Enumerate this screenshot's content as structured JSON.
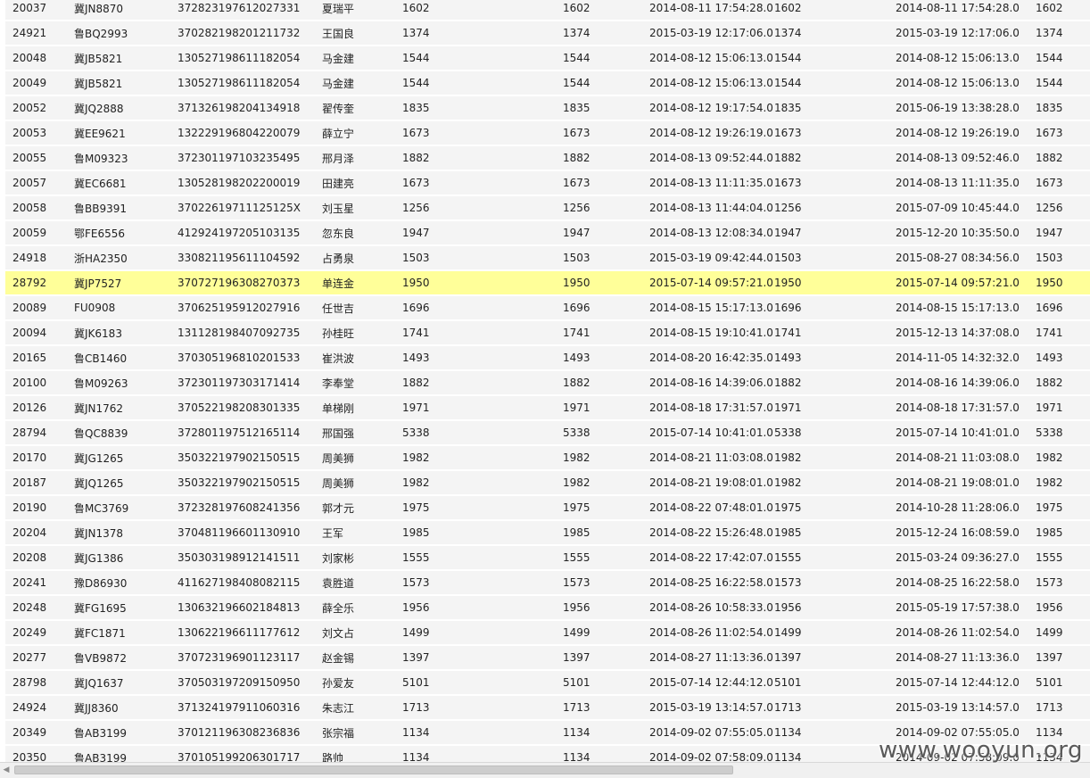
{
  "rows": [
    [
      "20037",
      "冀JN8870",
      "372823197612027331",
      "夏瑞平",
      "1602",
      "1602",
      "2014-08-11 17:54:28.0",
      "1602",
      "2014-08-11 17:54:28.0",
      "1602"
    ],
    [
      "24921",
      "鲁BQ2993",
      "370282198201211732",
      "王国良",
      "1374",
      "1374",
      "2015-03-19 12:17:06.0",
      "1374",
      "2015-03-19 12:17:06.0",
      "1374"
    ],
    [
      "20048",
      "冀JB5821",
      "130527198611182054",
      "马金建",
      "1544",
      "1544",
      "2014-08-12 15:06:13.0",
      "1544",
      "2014-08-12 15:06:13.0",
      "1544"
    ],
    [
      "20049",
      "冀JB5821",
      "130527198611182054",
      "马金建",
      "1544",
      "1544",
      "2014-08-12 15:06:13.0",
      "1544",
      "2014-08-12 15:06:13.0",
      "1544"
    ],
    [
      "20052",
      "冀JQ2888",
      "371326198204134918",
      "翟传奎",
      "1835",
      "1835",
      "2014-08-12 19:17:54.0",
      "1835",
      "2015-06-19 13:38:28.0",
      "1835"
    ],
    [
      "20053",
      "冀EE9621",
      "132229196804220079",
      "薛立宁",
      "1673",
      "1673",
      "2014-08-12 19:26:19.0",
      "1673",
      "2014-08-12 19:26:19.0",
      "1673"
    ],
    [
      "20055",
      "鲁M09323",
      "372301197103235495",
      "邢月泽",
      "1882",
      "1882",
      "2014-08-13 09:52:44.0",
      "1882",
      "2014-08-13 09:52:46.0",
      "1882"
    ],
    [
      "20057",
      "冀EC6681",
      "130528198202200019",
      "田建亮",
      "1673",
      "1673",
      "2014-08-13 11:11:35.0",
      "1673",
      "2014-08-13 11:11:35.0",
      "1673"
    ],
    [
      "20058",
      "鲁BB9391",
      "37022619711125125X",
      "刘玉星",
      "1256",
      "1256",
      "2014-08-13 11:44:04.0",
      "1256",
      "2015-07-09 10:45:44.0",
      "1256"
    ],
    [
      "20059",
      "鄂FE6556",
      "412924197205103135",
      "忽东良",
      "1947",
      "1947",
      "2014-08-13 12:08:34.0",
      "1947",
      "2015-12-20 10:35:50.0",
      "1947"
    ],
    [
      "24918",
      "浙HA2350",
      "330821195611104592",
      "占勇泉",
      "1503",
      "1503",
      "2015-03-19 09:42:44.0",
      "1503",
      "2015-08-27 08:34:56.0",
      "1503"
    ],
    [
      "28792",
      "冀JP7527",
      "370727196308270373",
      "单连金",
      "1950",
      "1950",
      "2015-07-14 09:57:21.0",
      "1950",
      "2015-07-14 09:57:21.0",
      "1950"
    ],
    [
      "20089",
      "FU0908",
      "370625195912027916",
      "任世吉",
      "1696",
      "1696",
      "2014-08-15 15:17:13.0",
      "1696",
      "2014-08-15 15:17:13.0",
      "1696"
    ],
    [
      "20094",
      "冀JK6183",
      "131128198407092735",
      "孙桂旺",
      "1741",
      "1741",
      "2014-08-15 19:10:41.0",
      "1741",
      "2015-12-13 14:37:08.0",
      "1741"
    ],
    [
      "20165",
      "鲁CB1460",
      "370305196810201533",
      "崔洪波",
      "1493",
      "1493",
      "2014-08-20 16:42:35.0",
      "1493",
      "2014-11-05 14:32:32.0",
      "1493"
    ],
    [
      "20100",
      "鲁M09263",
      "372301197303171414",
      "李奉堂",
      "1882",
      "1882",
      "2014-08-16 14:39:06.0",
      "1882",
      "2014-08-16 14:39:06.0",
      "1882"
    ],
    [
      "20126",
      "冀JN1762",
      "370522198208301335",
      "单梯刚",
      "1971",
      "1971",
      "2014-08-18 17:31:57.0",
      "1971",
      "2014-08-18 17:31:57.0",
      "1971"
    ],
    [
      "28794",
      "鲁QC8839",
      "372801197512165114",
      "邢国强",
      "5338",
      "5338",
      "2015-07-14 10:41:01.0",
      "5338",
      "2015-07-14 10:41:01.0",
      "5338"
    ],
    [
      "20170",
      "冀JG1265",
      "350322197902150515",
      "周美狮",
      "1982",
      "1982",
      "2014-08-21 11:03:08.0",
      "1982",
      "2014-08-21 11:03:08.0",
      "1982"
    ],
    [
      "20187",
      "冀JQ1265",
      "350322197902150515",
      "周美狮",
      "1982",
      "1982",
      "2014-08-21 19:08:01.0",
      "1982",
      "2014-08-21 19:08:01.0",
      "1982"
    ],
    [
      "20190",
      "鲁MC3769",
      "372328197608241356",
      "郭才元",
      "1975",
      "1975",
      "2014-08-22 07:48:01.0",
      "1975",
      "2014-10-28 11:28:06.0",
      "1975"
    ],
    [
      "20204",
      "冀JN1378",
      "370481196601130910",
      "王军",
      "1985",
      "1985",
      "2014-08-22 15:26:48.0",
      "1985",
      "2015-12-24 16:08:59.0",
      "1985"
    ],
    [
      "20208",
      "冀JG1386",
      "350303198912141511",
      "刘家彬",
      "1555",
      "1555",
      "2014-08-22 17:42:07.0",
      "1555",
      "2015-03-24 09:36:27.0",
      "1555"
    ],
    [
      "20241",
      "豫D86930",
      "411627198408082115",
      "袁胜道",
      "1573",
      "1573",
      "2014-08-25 16:22:58.0",
      "1573",
      "2014-08-25 16:22:58.0",
      "1573"
    ],
    [
      "20248",
      "冀FG1695",
      "130632196602184813",
      "薛全乐",
      "1956",
      "1956",
      "2014-08-26 10:58:33.0",
      "1956",
      "2015-05-19 17:57:38.0",
      "1956"
    ],
    [
      "20249",
      "冀FC1871",
      "130622196611177612",
      "刘文占",
      "1499",
      "1499",
      "2014-08-26 11:02:54.0",
      "1499",
      "2014-08-26 11:02:54.0",
      "1499"
    ],
    [
      "20277",
      "鲁VB9872",
      "370723196901123117",
      "赵金锡",
      "1397",
      "1397",
      "2014-08-27 11:13:36.0",
      "1397",
      "2014-08-27 11:13:36.0",
      "1397"
    ],
    [
      "28798",
      "冀JQ1637",
      "370503197209150950",
      "孙爱友",
      "5101",
      "5101",
      "2015-07-14 12:44:12.0",
      "5101",
      "2015-07-14 12:44:12.0",
      "5101"
    ],
    [
      "24924",
      "冀JJ8360",
      "371324197911060316",
      "朱志江",
      "1713",
      "1713",
      "2015-03-19 13:14:57.0",
      "1713",
      "2015-03-19 13:14:57.0",
      "1713"
    ],
    [
      "20349",
      "鲁AB3199",
      "370121196308236836",
      "张宗福",
      "1134",
      "1134",
      "2014-09-02 07:55:05.0",
      "1134",
      "2014-09-02 07:55:05.0",
      "1134"
    ],
    [
      "20350",
      "鲁AB3199",
      "370105199206301717",
      "路帅",
      "1134",
      "1134",
      "2014-09-02 07:58:09.0",
      "1134",
      "2014-09-02 07:58:09.0",
      "1134"
    ]
  ],
  "highlight_row_index": 11,
  "colors": {
    "highlight": "#ffff99",
    "row_bg": "#f4f4f4"
  },
  "scrollbar": {
    "left_arrow_icon": "chevron-left-icon"
  },
  "watermark": {
    "text": "www.wooyun.org"
  }
}
